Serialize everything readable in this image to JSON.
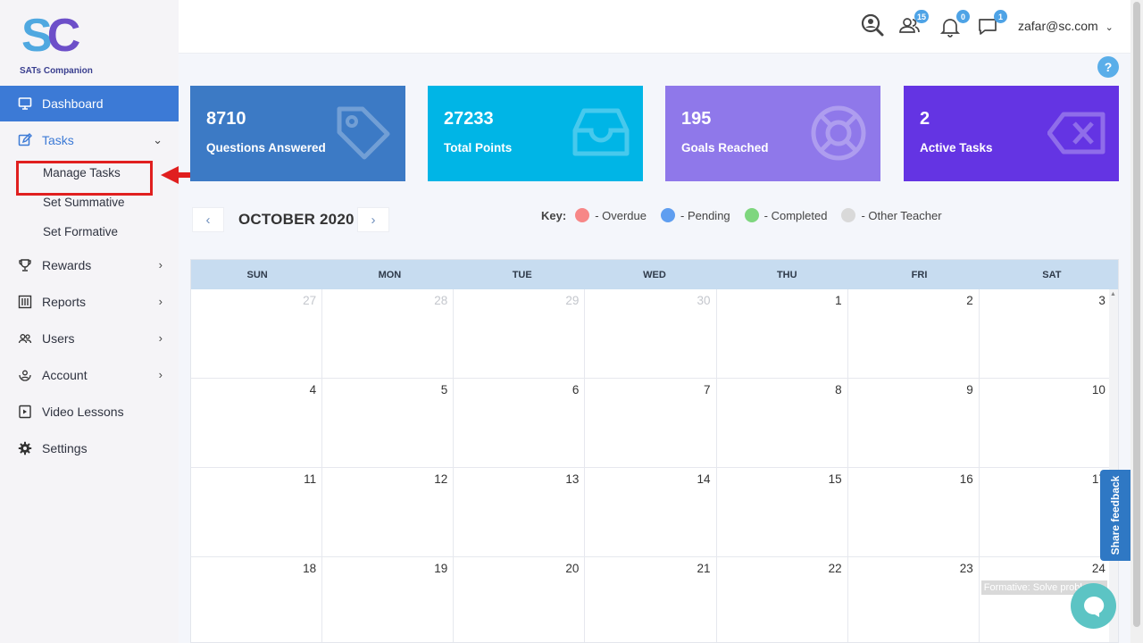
{
  "brand": {
    "logo_s": "S",
    "logo_c": "C",
    "tagline": "SATs Companion"
  },
  "sidebar": {
    "items": [
      {
        "label": "Dashboard",
        "icon": "monitor-icon"
      },
      {
        "label": "Tasks",
        "icon": "edit-icon"
      },
      {
        "label": "Rewards",
        "icon": "trophy-icon"
      },
      {
        "label": "Reports",
        "icon": "report-icon"
      },
      {
        "label": "Users",
        "icon": "users-icon"
      },
      {
        "label": "Account",
        "icon": "account-icon"
      },
      {
        "label": "Video Lessons",
        "icon": "video-icon"
      },
      {
        "label": "Settings",
        "icon": "gear-icon"
      }
    ],
    "task_subitems": [
      "Manage Tasks",
      "Set Summative",
      "Set Formative"
    ]
  },
  "topbar": {
    "users_badge": "15",
    "notifications_badge": "0",
    "messages_badge": "1",
    "user_email": "zafar@sc.com",
    "help": "?"
  },
  "stats": [
    {
      "value": "8710",
      "label": "Questions Answered",
      "color": "#3c7ac5",
      "icon": "tag-icon"
    },
    {
      "value": "27233",
      "label": "Total Points",
      "color": "#00b5e6",
      "icon": "inbox-icon"
    },
    {
      "value": "195",
      "label": "Goals Reached",
      "color": "#8f78ea",
      "icon": "lifebuoy-icon"
    },
    {
      "value": "2",
      "label": "Active Tasks",
      "color": "#6434e3",
      "icon": "backspace-icon"
    }
  ],
  "calendar": {
    "title": "OCTOBER 2020",
    "prev": "‹",
    "next": "›",
    "key_label": "Key:",
    "key": [
      {
        "label": "- Overdue",
        "color": "#f78787"
      },
      {
        "label": "- Pending",
        "color": "#5f9ef0"
      },
      {
        "label": "- Completed",
        "color": "#7ed67e"
      },
      {
        "label": "- Other Teacher",
        "color": "#d9d9d9"
      }
    ],
    "days_of_week": [
      "SUN",
      "MON",
      "TUE",
      "WED",
      "THU",
      "FRI",
      "SAT"
    ],
    "weeks": [
      [
        "27",
        "28",
        "29",
        "30",
        "1",
        "2",
        "3"
      ],
      [
        "4",
        "5",
        "6",
        "7",
        "8",
        "9",
        "10"
      ],
      [
        "11",
        "12",
        "13",
        "14",
        "15",
        "16",
        "17"
      ],
      [
        "18",
        "19",
        "20",
        "21",
        "22",
        "23",
        "24"
      ]
    ],
    "event": "Formative: Solve probl"
  },
  "feedback": "Share feedback"
}
